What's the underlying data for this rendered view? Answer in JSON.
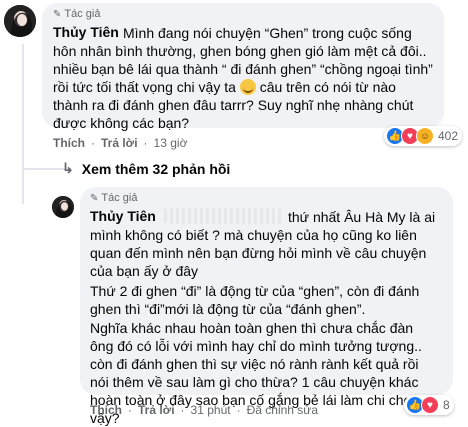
{
  "comment1": {
    "author_tag": "Tác giả",
    "author_name": "Thủy Tiên",
    "text_part1": "Mình đang nói chuyện “Ghen” trong cuộc sống hôn nhân bình thường, ghen bóng ghen gió làm mệt cả đôi.. nhiều bạn bê lái qua thành “ đi đánh ghen” “chồng ngoại tình” rồi tức tối thất vọng chi vậy ta",
    "text_part2": "câu trên có nói từ nào thành ra đi đánh ghen đâu tarrr? Suy nghĩ nhẹ nhàng chút được không các bạn?",
    "like_label": "Thích",
    "reply_label": "Trả lời",
    "time": "13 giờ",
    "reaction_count": "402",
    "reactions": [
      "like-icon",
      "love-icon",
      "haha-icon"
    ]
  },
  "view_more": "Xem thêm 32 phản hồi",
  "comment2": {
    "author_tag": "Tác giả",
    "author_name": "Thủy Tiên",
    "paragraph1": "thứ nhất Âu Hà My là ai mình không có biết ? mà chuyện của họ cũng ko liên quan đến mình nên bạn đừng hỏi mình về câu chuyện của bạn ấy ở đây",
    "paragraph2": "Thứ 2 đi ghen “đi” là động từ của “ghen”, còn đi đánh ghen thì “đi”mới là động từ của “đánh ghen”.",
    "paragraph3": "Nghĩa khác nhau hoàn toàn ghen thì chưa chắc đàn ông đó có lỗi với mình hay chỉ do mình tưởng tượng.. còn đi đánh ghen thì sự việc nó rành rành kết quả rồi nói thêm về sau làm gì cho thừa? 1 câu chuyện khác hoàn toàn ở đây sao bạn cố gắng bẻ lái làm chi cho mệt vậy?",
    "like_label": "Thích",
    "reply_label": "Trả lời",
    "time": "31 phút",
    "edited_label": "Đã chỉnh sửa",
    "reaction_count": "8",
    "reactions": [
      "like-icon",
      "love-icon"
    ]
  }
}
